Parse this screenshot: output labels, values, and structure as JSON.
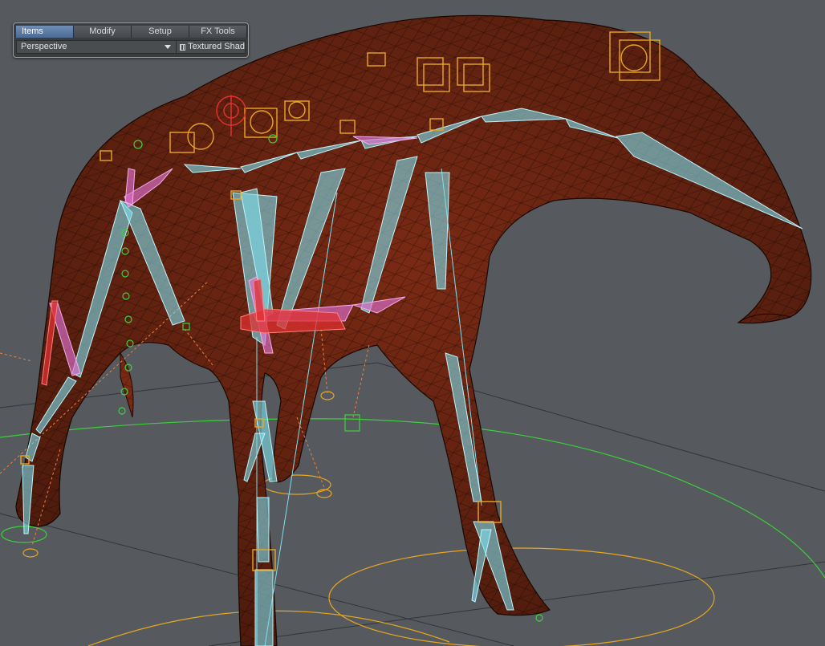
{
  "toolbar": {
    "tabs": [
      {
        "label": "Items",
        "active": true
      },
      {
        "label": "Modify",
        "active": false
      },
      {
        "label": "Setup",
        "active": false
      },
      {
        "label": "FX Tools",
        "active": false
      }
    ]
  },
  "viewport": {
    "view_mode": "Perspective",
    "shading_mode": "Textured Shad"
  },
  "colors": {
    "background": "#565a5e",
    "mesh": "#7a2a14",
    "bones": "#7fe0ee",
    "selected_bones": "#e070d0",
    "ik_bones": "#e03030",
    "null_items": "#e8a820",
    "green_items": "#40d040"
  }
}
